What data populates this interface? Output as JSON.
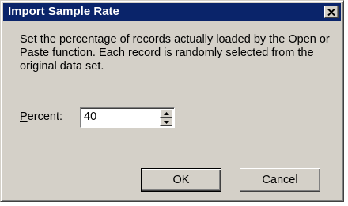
{
  "dialog": {
    "title": "Import Sample Rate",
    "close_icon": "close-icon",
    "message": "Set the percentage of records actually loaded by the Open or Paste function. Each record is randomly selected from the original data set.",
    "percent_label_mnemonic": "P",
    "percent_label_rest": "ercent:",
    "percent_value": "40",
    "ok_label": "OK",
    "cancel_label": "Cancel"
  },
  "colors": {
    "title_bar": "#0a246a",
    "dialog_face": "#d4d0c8",
    "title_text": "#ffffff"
  },
  "icons": {
    "spin_up": "up-arrow-icon",
    "spin_down": "down-arrow-icon"
  }
}
